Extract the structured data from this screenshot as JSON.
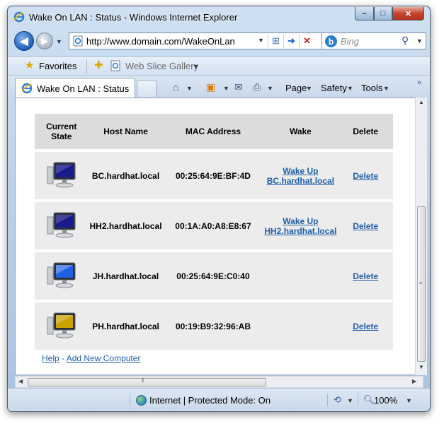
{
  "window": {
    "title": "Wake On LAN : Status - Windows Internet Explorer",
    "minimize": "–",
    "maximize": "□",
    "close": "✕"
  },
  "nav": {
    "back_glyph": "◀",
    "forward_glyph": "▶",
    "address": "http://www.domain.com/WakeOnLan",
    "search_placeholder": "Bing"
  },
  "favorites": {
    "label": "Favorites",
    "web_slice": "Web Slice Gallery"
  },
  "tabs": [
    {
      "label": "Wake On LAN : Status"
    }
  ],
  "commands": {
    "page": "Page",
    "safety": "Safety",
    "tools": "Tools"
  },
  "table": {
    "headers": {
      "state": "Current State",
      "host": "Host Name",
      "mac": "MAC Address",
      "wake": "Wake",
      "delete": "Delete"
    },
    "rows": [
      {
        "state": "off",
        "state_color": "#1a1a8c",
        "host": "BC.hardhat.local",
        "mac": "00:25:64:9E:BF:4D",
        "wake_line1": "Wake Up",
        "wake_line2": "BC.hardhat.local",
        "delete": "Delete"
      },
      {
        "state": "off",
        "state_color": "#1a1a8c",
        "host": "HH2.hardhat.local",
        "mac": "00:1A:A0:A8:E8:67",
        "wake_line1": "Wake Up",
        "wake_line2": "HH2.hardhat.local",
        "delete": "Delete"
      },
      {
        "state": "on",
        "state_color": "#1f5fe0",
        "host": "JH.hardhat.local",
        "mac": "00:25:64:9E:C0:40",
        "wake_line1": "",
        "wake_line2": "",
        "delete": "Delete"
      },
      {
        "state": "unknown",
        "state_color": "#c9a200",
        "host": "PH.hardhat.local",
        "mac": "00:19:B9:32:96:AB",
        "wake_line1": "",
        "wake_line2": "",
        "delete": "Delete"
      }
    ]
  },
  "footer": {
    "help": "Help",
    "separator": "-",
    "add": "Add New Computer"
  },
  "status": {
    "zone": "Internet | Protected Mode: On",
    "zoom": "100%"
  }
}
